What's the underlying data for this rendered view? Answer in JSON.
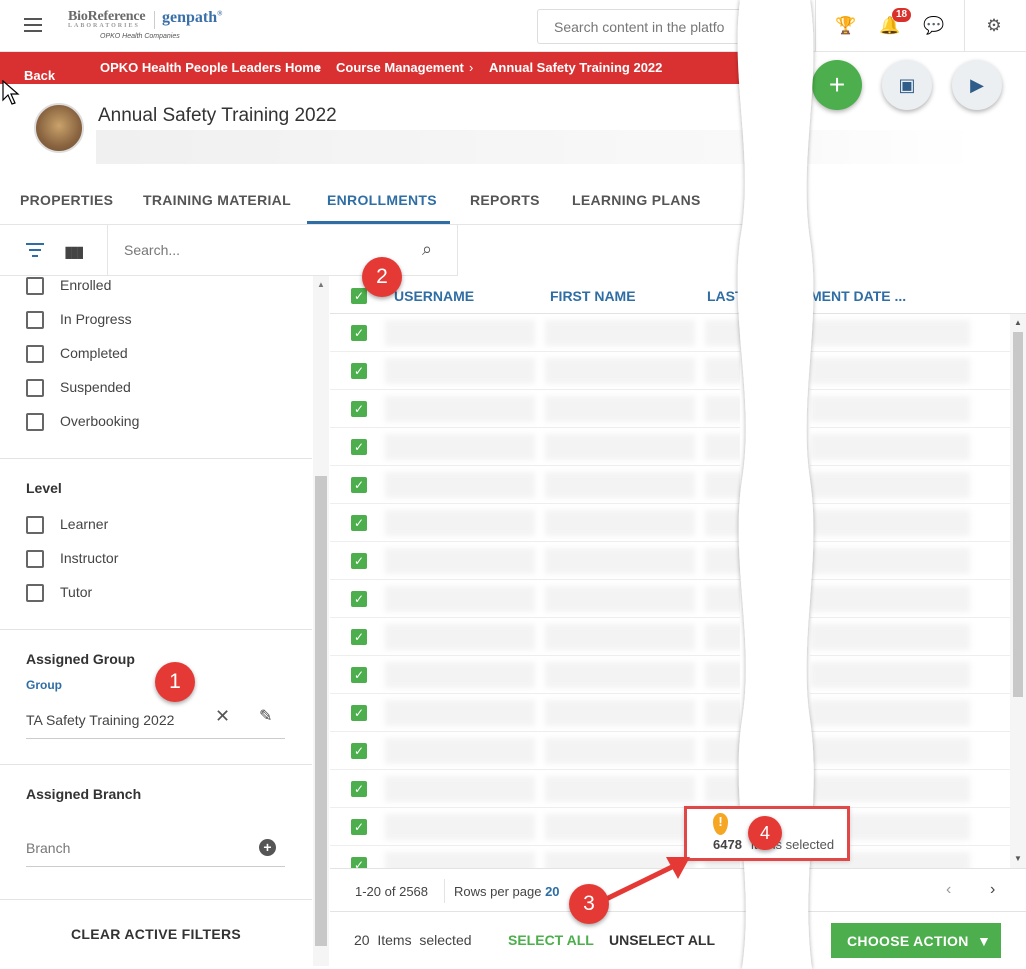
{
  "header": {
    "brand_line1": "BioReference",
    "brand_line1_sub": "LABORATORIES",
    "brand_line2": "genpath",
    "brand_tagline": "OPKO Health Companies",
    "search_placeholder": "Search content in the platfo",
    "notification_count": "18"
  },
  "breadcrumb": {
    "back": "Back",
    "items": [
      "OPKO Health People Leaders Home",
      "Course Management",
      "Annual Safety Training 2022"
    ]
  },
  "course": {
    "title": "Annual Safety Training 2022"
  },
  "tabs": [
    "PROPERTIES",
    "TRAINING MATERIAL",
    "ENROLLMENTS",
    "REPORTS",
    "LEARNING PLANS"
  ],
  "toolbar": {
    "search_placeholder": "Search..."
  },
  "filters": {
    "status_options": [
      "Enrolled",
      "In Progress",
      "Completed",
      "Suspended",
      "Overbooking"
    ],
    "level_heading": "Level",
    "level_options": [
      "Learner",
      "Instructor",
      "Tutor"
    ],
    "group_heading": "Assigned Group",
    "group_label": "Group",
    "group_value": "TA Safety Training 2022",
    "branch_heading": "Assigned Branch",
    "branch_placeholder": "Branch",
    "clear_label": "CLEAR ACTIVE FILTERS"
  },
  "grid": {
    "columns": [
      "USERNAME",
      "FIRST NAME",
      "LAST",
      "MENT DATE ..."
    ]
  },
  "tooltip": {
    "count": "6478",
    "label": "items selected"
  },
  "pager": {
    "range": "1-20 of 2568",
    "rows_label": "Rows per page",
    "rows_value": "20"
  },
  "selection": {
    "count": "20",
    "items_label": "Items",
    "selected_label": "selected",
    "select_all": "SELECT ALL",
    "unselect_all": "UNSELECT ALL",
    "choose_action": "CHOOSE ACTION"
  },
  "markers": [
    "1",
    "2",
    "3",
    "4"
  ],
  "colors": {
    "accent": "#2f6ea5",
    "breadcrumb": "#d93131",
    "green": "#4cae4c",
    "marker": "#e53935"
  }
}
